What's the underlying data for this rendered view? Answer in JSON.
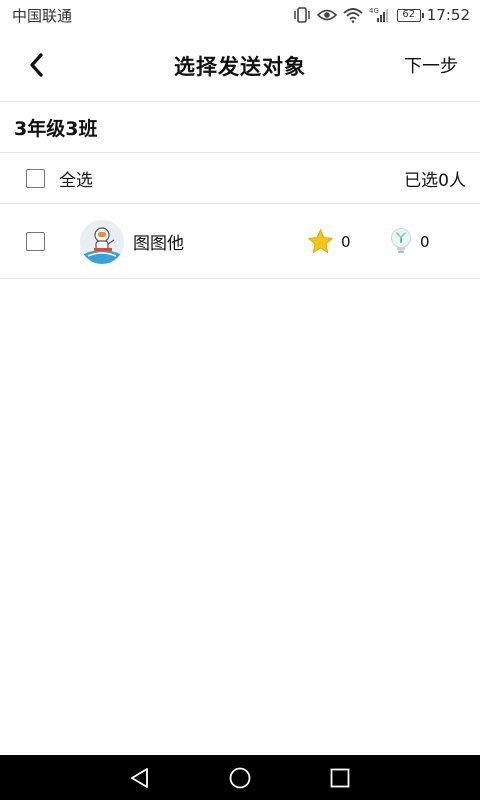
{
  "status_bar": {
    "carrier": "中国联通",
    "network": "4G",
    "battery": "62",
    "time": "17:52"
  },
  "header": {
    "back_icon": "chevron-left-icon",
    "title": "选择发送对象",
    "next_label": "下一步"
  },
  "class_name": "3年级3班",
  "select_all": {
    "label": "全选",
    "selected_count": "已选0人"
  },
  "students": [
    {
      "name": "图图他",
      "stars": "0",
      "bulbs": "0",
      "checked": false
    }
  ],
  "nav": {
    "back_icon": "triangle-back-icon",
    "home_icon": "circle-home-icon",
    "recent_icon": "square-recent-icon"
  },
  "colors": {
    "star": "#f5c518",
    "bulb": "#8fd3c8",
    "nav_bg": "#000000",
    "divider": "#e6e6e6"
  }
}
